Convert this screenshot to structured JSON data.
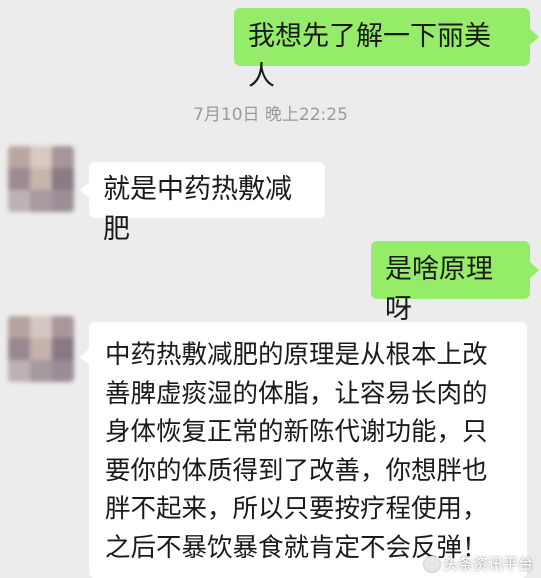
{
  "messages": [
    {
      "id": "m1",
      "side": "out",
      "text": "我想先了解一下丽美人"
    },
    {
      "id": "m2",
      "side": "in",
      "text": "就是中药热敷减肥"
    },
    {
      "id": "m3",
      "side": "out",
      "text": "是啥原理呀"
    },
    {
      "id": "m4",
      "side": "in",
      "text": "中药热敷减肥的原理是从根本上改\n善脾虚痰湿的体脂，让容易长肉的\n身体恢复正常的新陈代谢功能，只\n要你的体质得到了改善，你想胖也\n胖不起来，所以只要按疗程使用，\n之后不暴饮暴食就肯定不会反弹！"
    }
  ],
  "timestamp": "7月10日 晚上22:25",
  "watermark": "头条资讯平台",
  "colors": {
    "background": "#ececec",
    "outgoing_bubble": "#95ec69",
    "incoming_bubble": "#ffffff",
    "timestamp_text": "#9a9a9a"
  }
}
